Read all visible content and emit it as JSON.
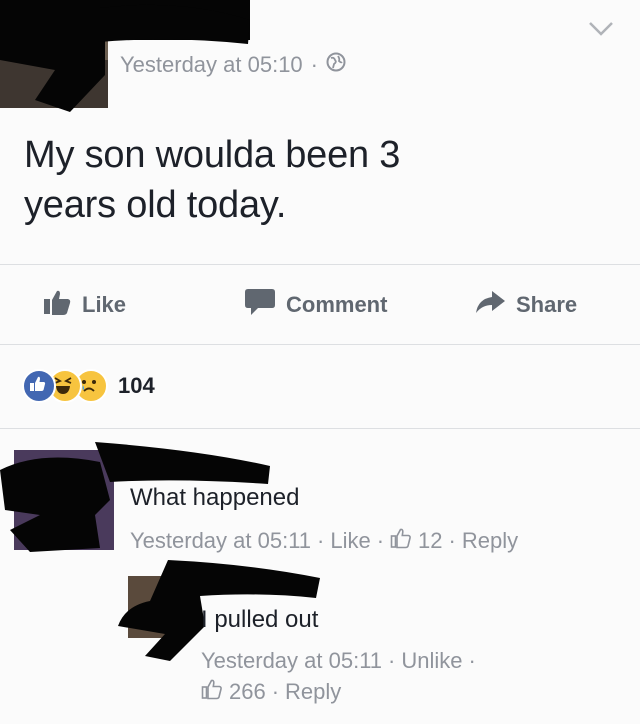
{
  "post": {
    "timestamp": "Yesterday at 05:10",
    "separator": "·",
    "privacy_icon": "globe-icon",
    "text_line1": "My son woulda been 3",
    "text_line2": "years old today."
  },
  "actions": {
    "like_label": "Like",
    "comment_label": "Comment",
    "share_label": "Share"
  },
  "reactions": {
    "icons": [
      "like-reaction-icon",
      "haha-reaction-icon",
      "sad-reaction-icon"
    ],
    "count": "104"
  },
  "comments": [
    {
      "text": "What happened",
      "timestamp": "Yesterday at 05:11",
      "action_label": "Like",
      "like_count": "12",
      "reply_label": "Reply"
    },
    {
      "text": "I pulled out",
      "timestamp": "Yesterday at 05:11",
      "action_label": "Unlike",
      "like_count": "266",
      "reply_label": "Reply"
    }
  ],
  "colors": {
    "meta_gray": "#90949c",
    "action_gray": "#606770",
    "text_dark": "#1d2129",
    "like_blue": "#4267b2",
    "emoji_yellow": "#f7c43f",
    "redaction": "#050505"
  }
}
